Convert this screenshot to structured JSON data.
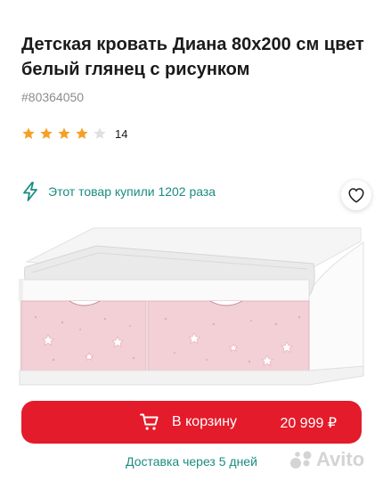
{
  "product": {
    "title": "Детская кровать Диана 80х200 см цвет белый глянец с рисунком",
    "sku": "#80364050",
    "rating": 4,
    "rating_max": 5,
    "reviews_count": "14"
  },
  "social_proof": {
    "text": "Этот товар купили 1202 раза",
    "icon": "lightning-icon"
  },
  "favorite": {
    "icon": "heart-icon"
  },
  "cart": {
    "label": "В корзину",
    "price": "20 999 ₽",
    "icon": "cart-icon"
  },
  "delivery": {
    "text": "Доставка через 5 дней"
  },
  "watermark": {
    "text": "Avito"
  },
  "colors": {
    "accent_red": "#e31b2a",
    "teal": "#1a8c82",
    "star_filled": "#f4a024",
    "star_empty": "#e0e0e0",
    "drawer_pink": "#f3cfd6"
  }
}
